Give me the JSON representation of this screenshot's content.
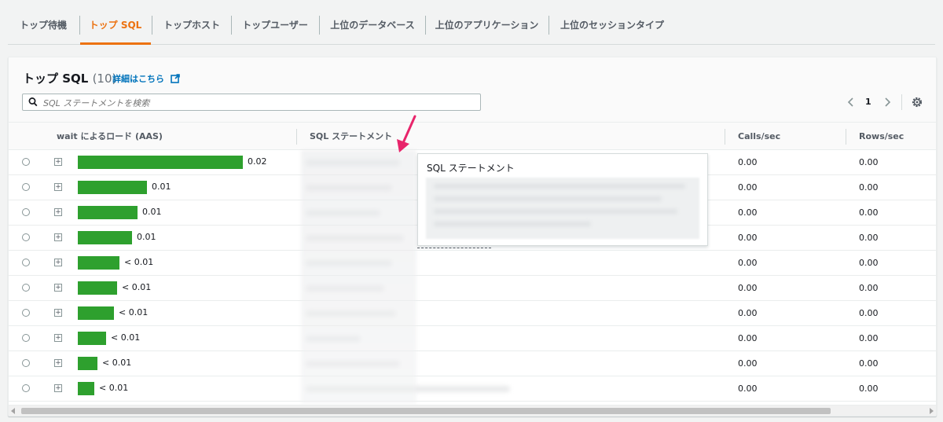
{
  "tabs": [
    {
      "label": "トップ待機"
    },
    {
      "label": "トップ SQL"
    },
    {
      "label": "トップホスト"
    },
    {
      "label": "トップユーザー"
    },
    {
      "label": "上位のデータベース"
    },
    {
      "label": "上位のアプリケーション"
    },
    {
      "label": "上位のセッションタイプ"
    }
  ],
  "active_tab": "トップ SQL",
  "panel": {
    "title": "トップ SQL",
    "count": "(10)",
    "info_link": "詳細はこちら"
  },
  "search": {
    "placeholder": "SQL ステートメントを検索"
  },
  "pagination": {
    "current_page": "1"
  },
  "table": {
    "columns": [
      "wait によるロード (AAS)",
      "SQL ステートメント",
      "Calls/sec",
      "Rows/sec"
    ],
    "max_load": 0.02,
    "rows": [
      {
        "load_label": "0.02",
        "load_fraction": 1.0,
        "calls": "0.00",
        "rows": "0.00"
      },
      {
        "load_label": "0.01",
        "load_fraction": 0.42,
        "calls": "0.00",
        "rows": "0.00"
      },
      {
        "load_label": "0.01",
        "load_fraction": 0.36,
        "calls": "0.00",
        "rows": "0.00"
      },
      {
        "load_label": "0.01",
        "load_fraction": 0.33,
        "calls": "0.00",
        "rows": "0.00"
      },
      {
        "load_label": "< 0.01",
        "load_fraction": 0.25,
        "calls": "0.00",
        "rows": "0.00"
      },
      {
        "load_label": "< 0.01",
        "load_fraction": 0.24,
        "calls": "0.00",
        "rows": "0.00"
      },
      {
        "load_label": "< 0.01",
        "load_fraction": 0.22,
        "calls": "0.00",
        "rows": "0.00"
      },
      {
        "load_label": "< 0.01",
        "load_fraction": 0.17,
        "calls": "0.00",
        "rows": "0.00"
      },
      {
        "load_label": "< 0.01",
        "load_fraction": 0.12,
        "calls": "0.00",
        "rows": "0.00"
      },
      {
        "load_label": "< 0.01",
        "load_fraction": 0.1,
        "calls": "0.00",
        "rows": "0.00"
      }
    ]
  },
  "popover": {
    "title": "SQL ステートメント"
  },
  "colors": {
    "accent": "#ec7211",
    "bar": "#2ea02e",
    "link": "#0073bb",
    "annotation_arrow": "#e8256b"
  }
}
